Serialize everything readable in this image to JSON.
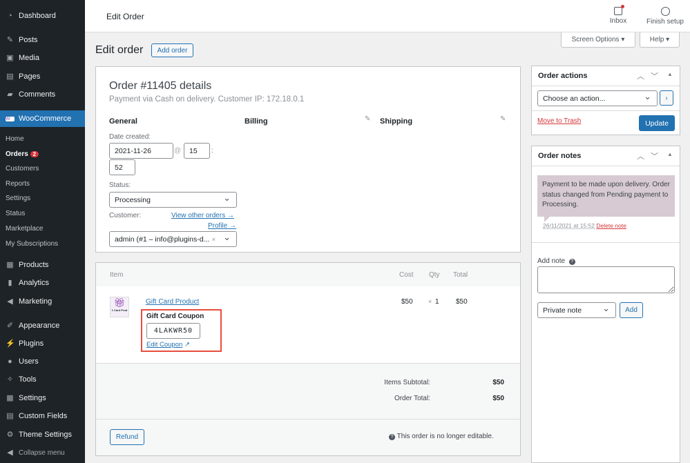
{
  "sidebar": {
    "dashboard": "Dashboard",
    "posts": "Posts",
    "media": "Media",
    "pages": "Pages",
    "comments": "Comments",
    "woocommerce": "WooCommerce",
    "woo_sub": [
      "Home",
      "Orders",
      "Customers",
      "Reports",
      "Settings",
      "Status",
      "Marketplace",
      "My Subscriptions"
    ],
    "orders_badge": "2",
    "lower": [
      "Products",
      "Analytics",
      "Marketing",
      "Appearance",
      "Plugins",
      "Users",
      "Tools",
      "Settings",
      "Custom Fields",
      "Theme Settings"
    ],
    "collapse": "Collapse menu"
  },
  "topbar": {
    "title": "Edit Order",
    "inbox": "Inbox",
    "finish": "Finish setup"
  },
  "screen_options": "Screen Options",
  "help": "Help",
  "page": {
    "title": "Edit order",
    "add_order": "Add order"
  },
  "order": {
    "heading": "Order #11405 details",
    "subtitle": "Payment via Cash on delivery. Customer IP: 172.18.0.1",
    "general": "General",
    "billing": "Billing",
    "shipping": "Shipping",
    "date_label": "Date created:",
    "date": "2021-11-26",
    "at": "@",
    "hour": "15",
    "colon": ":",
    "minute": "52",
    "status_label": "Status:",
    "status": "Processing",
    "customer_label": "Customer:",
    "view_other": "View other orders →",
    "profile": "Profile →",
    "customer": "admin (#1 – info@plugins-d...",
    "clear": "×"
  },
  "items": {
    "col_item": "Item",
    "col_cost": "Cost",
    "col_qty": "Qty",
    "col_total": "Total",
    "thumb_text": "1 Card Prod",
    "product": "Gift Card Product",
    "coupon_label": "Gift Card Coupon",
    "coupon_code": "4LAKWR50",
    "edit_coupon": "Edit Coupon",
    "cost": "$50",
    "qty_x": "×",
    "qty": "1",
    "total": "$50",
    "subtotal_label": "Items Subtotal:",
    "subtotal": "$50",
    "order_total_label": "Order Total:",
    "order_total": "$50",
    "refund": "Refund",
    "not_editable": "This order is no longer editable."
  },
  "actions": {
    "title": "Order actions",
    "choose": "Choose an action...",
    "trash": "Move to Trash",
    "update": "Update"
  },
  "notes": {
    "title": "Order notes",
    "note": "Payment to be made upon delivery. Order status changed from Pending payment to Processing.",
    "date": "26/11/2021 at 15:52",
    "delete": "Delete note",
    "add_label": "Add note",
    "type": "Private note",
    "add": "Add"
  },
  "colors": {
    "accent": "#2271b1",
    "highlight": "#e74c3c",
    "note_bg": "#d7cad2"
  }
}
